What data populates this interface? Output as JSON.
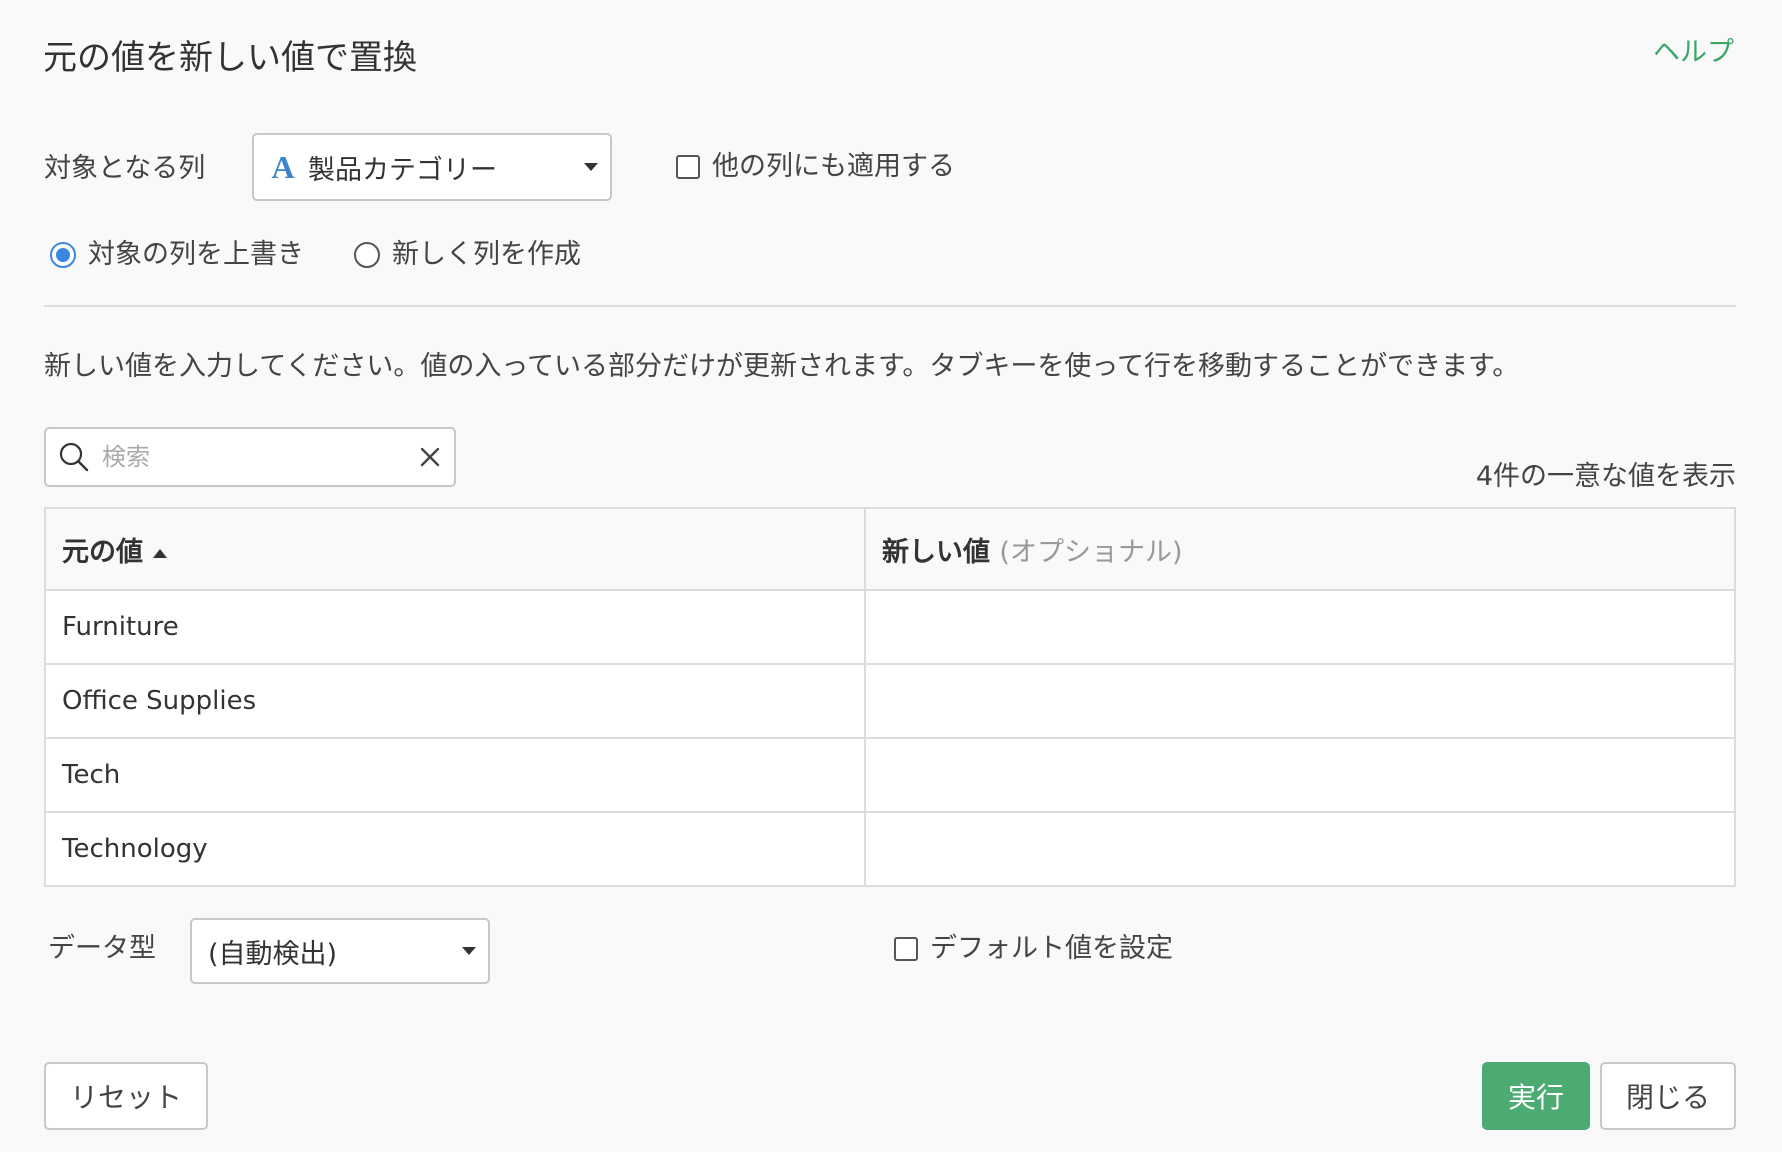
{
  "dialog": {
    "title": "元の値を新しい値で置換",
    "help_label": "ヘルプ"
  },
  "target_column": {
    "label": "対象となる列",
    "type_icon": "A",
    "selected": "製品カテゴリー",
    "apply_other_label": "他の列にも適用する",
    "apply_other_checked": false
  },
  "output_mode": {
    "overwrite_label": "対象の列を上書き",
    "create_new_label": "新しく列を作成",
    "selected": "overwrite"
  },
  "instructions": "新しい値を入力してください。値の入っている部分だけが更新されます。タブキーを使って行を移動することができます。",
  "search": {
    "placeholder": "検索",
    "value": ""
  },
  "unique_count_text": "4件の一意な値を表示",
  "table": {
    "header_original": "元の値",
    "header_new": "新しい値",
    "header_new_optional": "(オプショナル)",
    "sort_direction": "ascending",
    "rows": [
      {
        "original": "Furniture",
        "new": ""
      },
      {
        "original": "Office Supplies",
        "new": ""
      },
      {
        "original": "Tech",
        "new": ""
      },
      {
        "original": "Technology",
        "new": ""
      }
    ]
  },
  "data_type": {
    "label": "データ型",
    "selected": "(自動検出)"
  },
  "default_value": {
    "label": "デフォルト値を設定",
    "checked": false
  },
  "buttons": {
    "reset": "リセット",
    "run": "実行",
    "close": "閉じる"
  },
  "colors": {
    "accent_green": "#4caa73",
    "help_link": "#3aa66a",
    "radio_selected": "#3a86e0",
    "type_icon": "#3a86c9"
  }
}
